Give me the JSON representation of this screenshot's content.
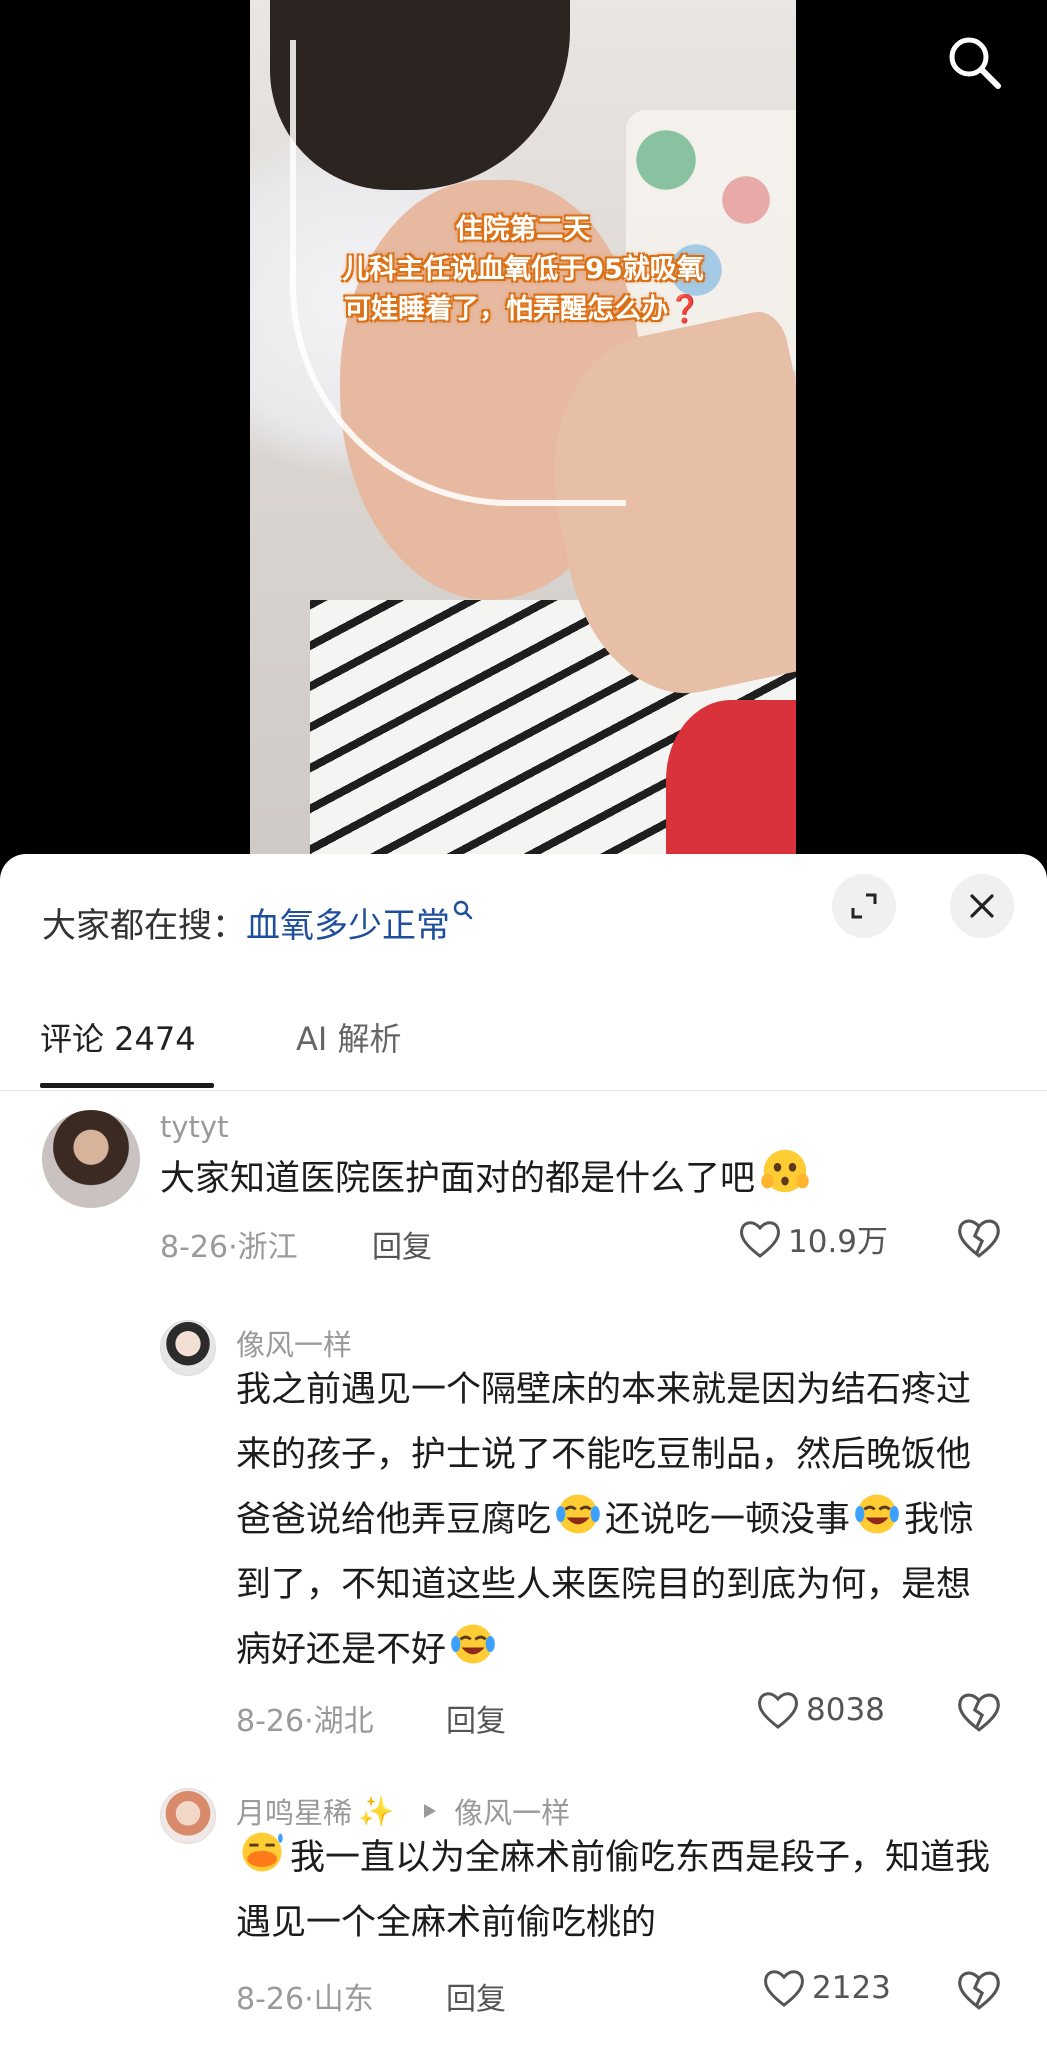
{
  "video": {
    "caption_lines": [
      "住院第二天",
      "儿科主任说血氧低于95就吸氧",
      "可娃睡着了，怕弄醒怎么办"
    ],
    "caption_mark": "❓"
  },
  "top_bar": {
    "search_icon": "search-icon"
  },
  "sheet": {
    "search_prefix": "大家都在搜：",
    "search_keyword": "血氧多少正常",
    "expand_icon": "expand-icon",
    "close_icon": "close-icon"
  },
  "tabs": [
    {
      "label": "评论 2474",
      "active": true
    },
    {
      "label": "AI 解析",
      "active": false
    }
  ],
  "comments": [
    {
      "user": "tytyt",
      "text": "大家知道医院医护面对的都是什么了吧",
      "emoji": "shocked-emoji",
      "date_loc": "8-26·浙江",
      "reply_label": "回复",
      "likes": "10.9万"
    },
    {
      "user": "像风一样",
      "text_parts": [
        "我之前遇见一个隔壁床的本来就是因为结石疼过来的孩子，护士说了不能吃豆制品，然后晚饭他爸爸说给他弄豆腐吃",
        "还说吃一顿没事",
        "我惊到了，不知道这些人来医院目的到底为何，是想病好还是不好"
      ],
      "emoji": "crying-laughing-emoji",
      "date_loc": "8-26·湖北",
      "reply_label": "回复",
      "likes": "8038"
    },
    {
      "user": "月鸣星稀",
      "user_badge": "✨",
      "reply_to": "像风一样",
      "text": "我一直以为全麻术前偷吃东西是段子，知道我遇见一个全麻术前偷吃桃的",
      "emoji": "duck-emoji",
      "date_loc": "8-26·山东",
      "reply_label": "回复",
      "likes": "2123"
    }
  ],
  "colors": {
    "keyword": "#1f4f9c",
    "caption_stroke": "#e07a1f",
    "meta": "#9a9a9a"
  }
}
